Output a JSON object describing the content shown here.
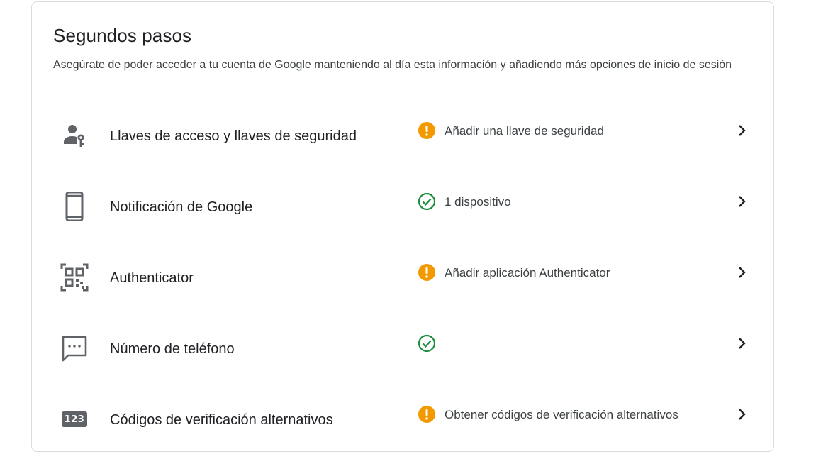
{
  "section": {
    "title": "Segundos pasos",
    "description": "Asegúrate de poder acceder a tu cuenta de Google manteniendo al día esta información y añadiendo más opciones de inicio de sesión"
  },
  "items": [
    {
      "label": "Llaves de acceso y llaves de seguridad",
      "icon": "passkey-icon",
      "status": "warning",
      "status_text": "Añadir una llave de seguridad"
    },
    {
      "label": "Notificación de Google",
      "icon": "phone-icon",
      "status": "ok",
      "status_text": "1 dispositivo"
    },
    {
      "label": "Authenticator",
      "icon": "qr-code-icon",
      "status": "warning",
      "status_text": "Añadir aplicación Authenticator"
    },
    {
      "label": "Número de teléfono",
      "icon": "sms-icon",
      "status": "ok",
      "status_text": ""
    },
    {
      "label": "Códigos de verificación alternativos",
      "icon": "backup-codes-icon",
      "icon_text": "123",
      "status": "warning",
      "status_text": "Obtener códigos de verificación alternativos"
    }
  ],
  "colors": {
    "warning": "#f29900",
    "ok": "#1e8e3e",
    "icon": "#5f6368"
  }
}
